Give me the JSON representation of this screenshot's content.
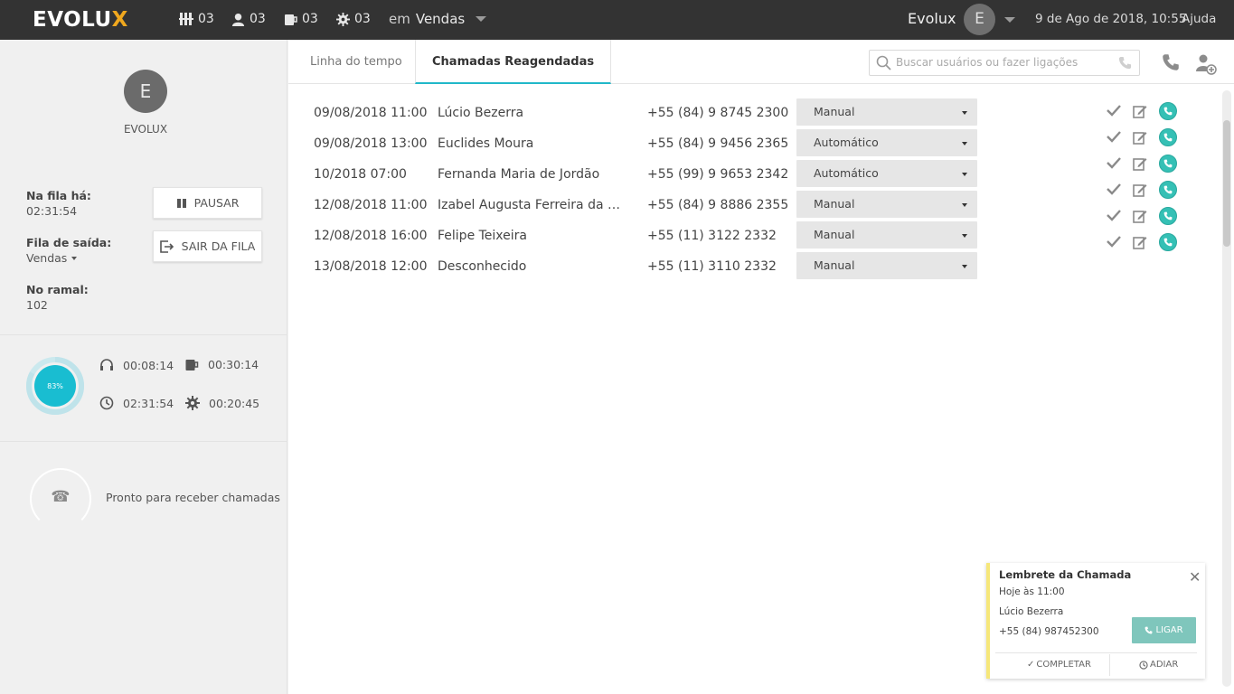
{
  "colors": {
    "topbar": "#333333",
    "accent": "#21b8c9",
    "call_green": "#35c0b5",
    "logo_x": "#f0a81e",
    "reminder_stripe": "#f6e77a"
  },
  "topbar": {
    "logo": "EVOLU",
    "logo_x": "X",
    "stats": [
      {
        "icon": "queue-icon",
        "value": "03"
      },
      {
        "icon": "user-icon",
        "value": "03"
      },
      {
        "icon": "coffee-icon",
        "value": "03"
      },
      {
        "icon": "gear-icon",
        "value": "03"
      }
    ],
    "queue_prefix": "em",
    "queue_name": "Vendas",
    "user_name": "Evolux",
    "user_initial": "E",
    "datetime": "9 de Ago de 2018, 10:55",
    "help": "Ajuda"
  },
  "sidebar": {
    "avatar_initial": "E",
    "agent_name": "EVOLUX",
    "queue_time_label": "Na fila há:",
    "queue_time": "02:31:54",
    "exit_queue_label": "Fila de saída:",
    "exit_queue": "Vendas",
    "extension_label": "No ramal:",
    "extension": "102",
    "pause_label": "PAUSAR",
    "leave_label": "SAIR DA FILA",
    "occupancy": 0.83,
    "occupancy_label": "83%",
    "timers": {
      "talk": "00:08:14",
      "pause": "00:30:14",
      "total": "02:31:54",
      "other": "00:20:45"
    },
    "status": "Pronto para receber chamadas"
  },
  "main": {
    "tabs": [
      {
        "label": "Linha do tempo"
      },
      {
        "label": "Chamadas Reagendadas"
      }
    ],
    "search_placeholder": "Buscar usuários ou fazer ligações",
    "rows": [
      {
        "date": "09/08/2018 11:00",
        "name": "Lúcio Bezerra",
        "phone": "+55 (84) 9 8745 2300",
        "mode": "Manual"
      },
      {
        "date": "09/08/2018 13:00",
        "name": "Euclides Moura",
        "phone": "+55 (84) 9 9456 2365",
        "mode": "Automático"
      },
      {
        "date": "10/2018 07:00",
        "name": "Fernanda Maria de Jordão",
        "phone": "+55 (99) 9 9653 2342",
        "mode": "Automático"
      },
      {
        "date": "12/08/2018 11:00",
        "name": "Izabel Augusta Ferreira da Sil...",
        "phone": "+55 (84) 9 8886 2355",
        "mode": "Manual"
      },
      {
        "date": "12/08/2018 16:00",
        "name": "Felipe Teixeira",
        "phone": "+55 (11) 3122 2332",
        "mode": "Manual"
      },
      {
        "date": "13/08/2018 12:00",
        "name": "Desconhecido",
        "phone": "+55 (11) 3110 2332",
        "mode": "Manual"
      }
    ]
  },
  "reminder": {
    "title": "Lembrete da Chamada",
    "when": "Hoje às 11:00",
    "name": "Lúcio Bezerra",
    "phone": "+55 (84) 987452300",
    "call_label": "LIGAR",
    "complete_label": "COMPLETAR",
    "postpone_label": "ADIAR"
  }
}
